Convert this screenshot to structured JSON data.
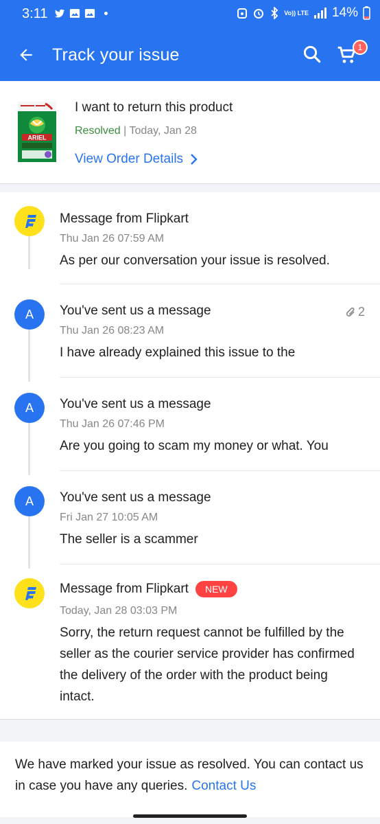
{
  "status_bar": {
    "time": "3:11",
    "network": "LTE1",
    "volte": "Vo)) LTE",
    "battery": "14%"
  },
  "header": {
    "title": "Track your issue",
    "cart_count": "1"
  },
  "product": {
    "title": "I want to return this product",
    "status": "Resolved",
    "separator": " | ",
    "date": "Today, Jan 28",
    "view_order_label": "View Order Details"
  },
  "messages": [
    {
      "sender": "flipkart",
      "title": "Message from Flipkart",
      "time": "Thu Jan 26 07:59 AM",
      "body": "As per our conversation your issue is resolved."
    },
    {
      "sender": "user",
      "avatar_letter": "A",
      "title": "You've sent us a message",
      "time": "Thu Jan 26 08:23 AM",
      "body": "I have already explained this issue to the",
      "attachments": "2"
    },
    {
      "sender": "user",
      "avatar_letter": "A",
      "title": "You've sent us a message",
      "time": "Thu Jan 26 07:46 PM",
      "body": "Are you going to scam my money or what. You"
    },
    {
      "sender": "user",
      "avatar_letter": "A",
      "title": "You've sent us a message",
      "time": "Fri Jan 27 10:05 AM",
      "body": "The seller is a scammer"
    },
    {
      "sender": "flipkart",
      "title": "Message from Flipkart",
      "badge": "NEW",
      "time": "Today, Jan 28 03:03 PM",
      "body": "Sorry, the return request cannot be fulfilled by the seller as the courier service provider has confirmed the delivery of the order with the product being intact."
    }
  ],
  "footer": {
    "note": "We have marked your issue as resolved. You can contact us in case you have any queries.",
    "contact_label": "Contact Us"
  },
  "product_image_text": "ARIEL",
  "colors": {
    "brand_blue": "#2874f0",
    "resolved_green": "#388e3c",
    "new_badge_red": "#ff4343",
    "flipkart_yellow": "#ffe11b"
  }
}
